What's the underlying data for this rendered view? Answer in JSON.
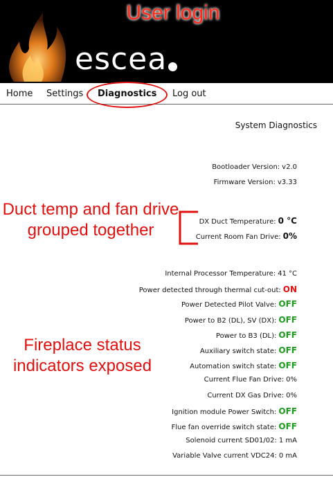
{
  "annotations": {
    "login": "User login",
    "duct": "Duct temp and fan drive grouped together",
    "fireplace": "Fireplace status indicators exposed"
  },
  "brand": {
    "logo_text": "escea"
  },
  "nav": {
    "home": "Home",
    "settings": "Settings",
    "diagnostics": "Diagnostics",
    "logout": "Log out"
  },
  "page_title": "System Diagnostics",
  "diagnostics": [
    {
      "label": "Bootloader Version:",
      "value": "v2.0"
    },
    {
      "label": "Firmware Version:",
      "value": "v3.33"
    },
    {
      "label": "DX Duct Temperature:",
      "value": "0 °C"
    },
    {
      "label": "Current Room Fan Drive:",
      "value": "0%"
    },
    {
      "label": "Internal Processor Temperature:",
      "value": "41 °C"
    },
    {
      "label": "Power detected through thermal cut-out:",
      "value": "ON"
    },
    {
      "label": "Power Detected Pilot Valve:",
      "value": "OFF"
    },
    {
      "label": "Power to B2 (DL), SV (DX):",
      "value": "OFF"
    },
    {
      "label": "Power to B3 (DL):",
      "value": "OFF"
    },
    {
      "label": "Auxiliary switch state:",
      "value": "OFF"
    },
    {
      "label": "Automation switch state:",
      "value": "OFF"
    },
    {
      "label": "Current Flue Fan Drive:",
      "value": "0%"
    },
    {
      "label": "Current DX Gas Drive:",
      "value": "0%"
    },
    {
      "label": "Ignition module Power Switch:",
      "value": "OFF"
    },
    {
      "label": "Flue fan override switch state:",
      "value": "OFF"
    },
    {
      "label": "Solenoid current SD01/02:",
      "value": "1 mA"
    },
    {
      "label": "Variable Valve current VDC24:",
      "value": "0 mA"
    }
  ],
  "colors": {
    "on": "#e0100e",
    "off": "#1e9a1e",
    "annotation": "#e0100e"
  }
}
